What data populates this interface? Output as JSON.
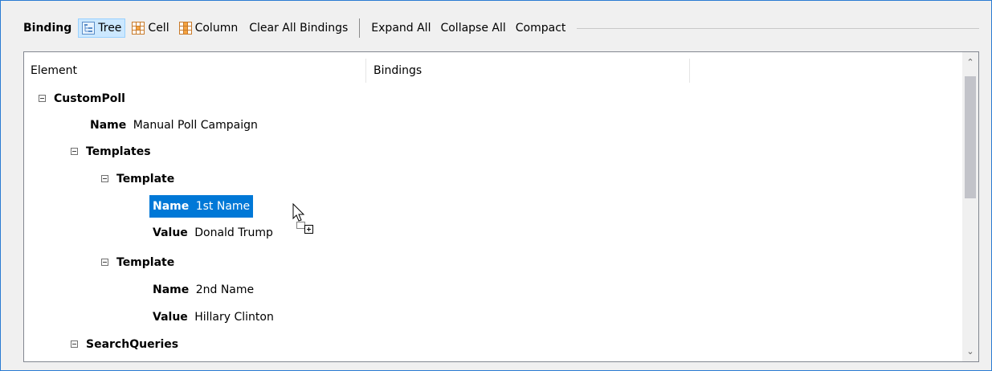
{
  "toolbar": {
    "label": "Binding",
    "modes": [
      {
        "label": "Tree",
        "icon": "tree-icon",
        "active": true
      },
      {
        "label": "Cell",
        "icon": "cell-grid-icon",
        "active": false
      },
      {
        "label": "Column",
        "icon": "column-grid-icon",
        "active": false
      }
    ],
    "clear_label": "Clear All Bindings",
    "expand_label": "Expand All",
    "collapse_label": "Collapse All",
    "compact_label": "Compact"
  },
  "tree": {
    "columns": [
      "Element",
      "Bindings"
    ],
    "rows": [
      {
        "label": "CustomPoll",
        "value": ""
      },
      {
        "label": "Name",
        "value": "Manual Poll Campaign"
      },
      {
        "label": "Templates",
        "value": ""
      },
      {
        "label": "Template",
        "value": ""
      },
      {
        "label": "Name",
        "value": "1st Name"
      },
      {
        "label": "Value",
        "value": "Donald Trump"
      },
      {
        "label": "Template",
        "value": ""
      },
      {
        "label": "Name",
        "value": "2nd Name"
      },
      {
        "label": "Value",
        "value": "Hillary Clinton"
      },
      {
        "label": "SearchQueries",
        "value": ""
      }
    ]
  },
  "colors": {
    "selection": "#0078d7",
    "active_toggle": "#cce8ff",
    "window_border": "#2b7cd3"
  }
}
